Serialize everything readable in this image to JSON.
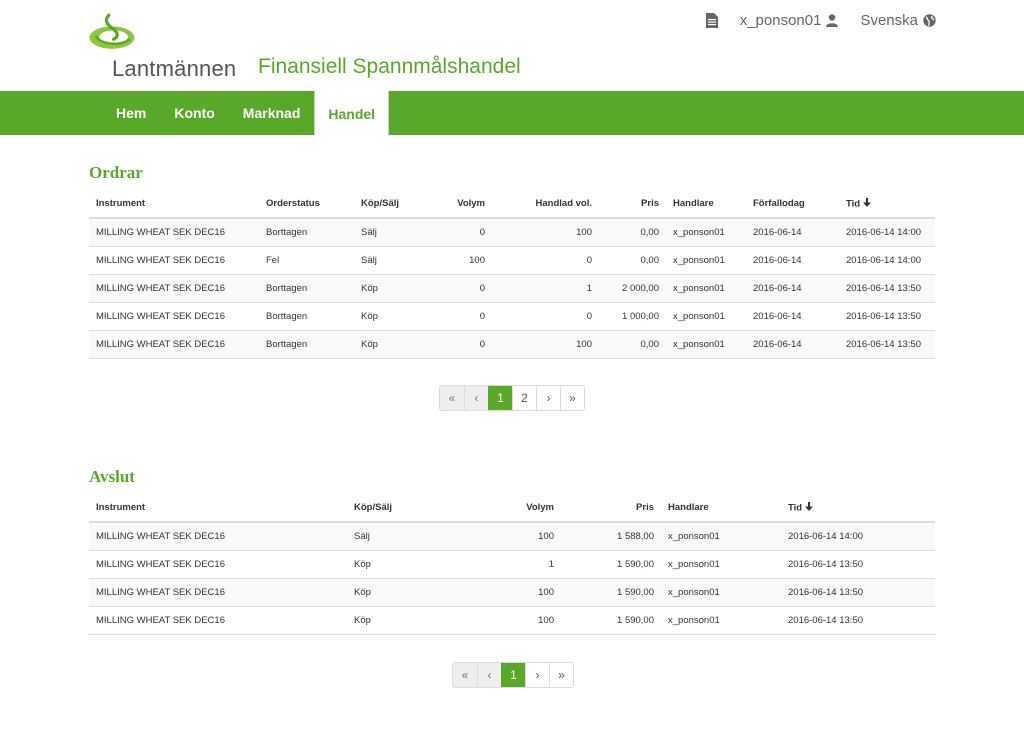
{
  "header": {
    "logo_text": "Lantmännen",
    "site_title": "Finansiell Spannmålshandel",
    "user": "x_ponson01",
    "language": "Svenska",
    "brand_color": "#5aa82a"
  },
  "nav": {
    "items": [
      "Hem",
      "Konto",
      "Marknad",
      "Handel"
    ],
    "active": "Handel"
  },
  "orders": {
    "title": "Ordrar",
    "columns": [
      "Instrument",
      "Orderstatus",
      "Köp/Sälj",
      "Volym",
      "Handlad vol.",
      "Pris",
      "Handlare",
      "Förfallodag",
      "Tid"
    ],
    "rows": [
      [
        "MILLING WHEAT SEK DEC16",
        "Borttagen",
        "Sälj",
        "0",
        "100",
        "0,00",
        "x_ponson01",
        "2016-06-14",
        "2016-06-14 14:00"
      ],
      [
        "MILLING WHEAT SEK DEC16",
        "Fel",
        "Sälj",
        "100",
        "0",
        "0,00",
        "x_ponson01",
        "2016-06-14",
        "2016-06-14 14:00"
      ],
      [
        "MILLING WHEAT SEK DEC16",
        "Borttagen",
        "Köp",
        "0",
        "1",
        "2 000,00",
        "x_ponson01",
        "2016-06-14",
        "2016-06-14 13:50"
      ],
      [
        "MILLING WHEAT SEK DEC16",
        "Borttagen",
        "Köp",
        "0",
        "0",
        "1 000,00",
        "x_ponson01",
        "2016-06-14",
        "2016-06-14 13:50"
      ],
      [
        "MILLING WHEAT SEK DEC16",
        "Borttagen",
        "Köp",
        "0",
        "100",
        "0,00",
        "x_ponson01",
        "2016-06-14",
        "2016-06-14 13:50"
      ]
    ],
    "pagination": [
      "«",
      "‹",
      "1",
      "2",
      "›",
      "»"
    ],
    "current_page": "1"
  },
  "trades": {
    "title": "Avslut",
    "columns": [
      "Instrument",
      "Köp/Sälj",
      "Volym",
      "Pris",
      "Handlare",
      "Tid"
    ],
    "rows": [
      [
        "MILLING WHEAT SEK DEC16",
        "Sälj",
        "100",
        "1 588,00",
        "x_ponson01",
        "2016-06-14 14:00"
      ],
      [
        "MILLING WHEAT SEK DEC16",
        "Köp",
        "1",
        "1 590,00",
        "x_ponson01",
        "2016-06-14 13:50"
      ],
      [
        "MILLING WHEAT SEK DEC16",
        "Köp",
        "100",
        "1 590,00",
        "x_ponson01",
        "2016-06-14 13:50"
      ],
      [
        "MILLING WHEAT SEK DEC16",
        "Köp",
        "100",
        "1 590,00",
        "x_ponson01",
        "2016-06-14 13:50"
      ]
    ],
    "pagination": [
      "«",
      "‹",
      "1",
      "›",
      "»"
    ],
    "current_page": "1"
  },
  "icons": {
    "document": "document-icon",
    "user": "user-icon",
    "globe": "globe-icon",
    "sort": "sort-down-arrow-icon"
  }
}
